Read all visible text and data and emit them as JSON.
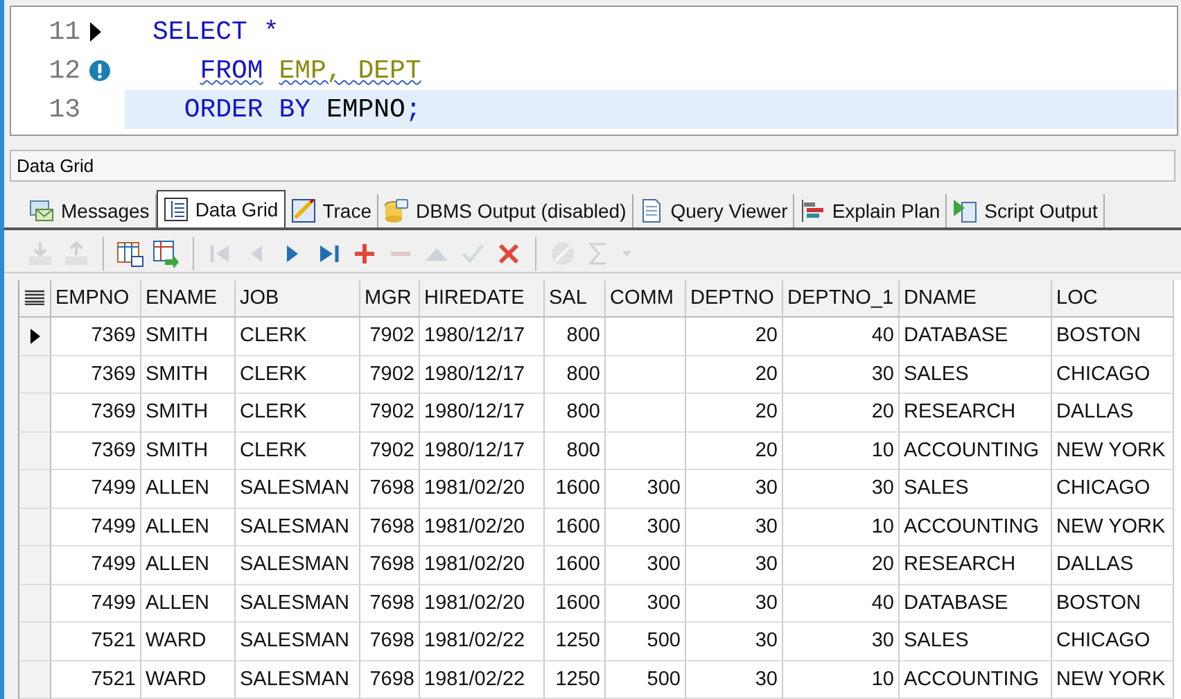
{
  "editor": {
    "lines": [
      {
        "number": "11",
        "execution_point": true,
        "warning": false,
        "current": false,
        "tokens": [
          {
            "text": "SELECT *",
            "kind": "keyword",
            "underlined": false
          }
        ]
      },
      {
        "number": "12",
        "execution_point": false,
        "warning": true,
        "current": false,
        "tokens": [
          {
            "text": "   FROM",
            "kind": "keyword",
            "underlined": true
          },
          {
            "text": " EMP, DEPT",
            "kind": "identifier",
            "underlined": true
          }
        ]
      },
      {
        "number": "13",
        "execution_point": false,
        "warning": false,
        "current": true,
        "tokens": [
          {
            "text": "  ORDER BY",
            "kind": "keyword",
            "underlined": false
          },
          {
            "text": " EMPNO",
            "kind": "plain",
            "underlined": false
          },
          {
            "text": ";",
            "kind": "keyword",
            "underlined": false
          }
        ]
      }
    ]
  },
  "panel": {
    "title": "Data Grid"
  },
  "tabs": [
    {
      "label": "Messages",
      "selected": false
    },
    {
      "label": "Data Grid",
      "selected": true
    },
    {
      "label": "Trace",
      "selected": false
    },
    {
      "label": "DBMS Output (disabled)",
      "selected": false
    },
    {
      "label": "Query Viewer",
      "selected": false
    },
    {
      "label": "Explain Plan",
      "selected": false
    },
    {
      "label": "Script Output",
      "selected": false
    }
  ],
  "toolbar": [
    {
      "kind": "export",
      "disabled": true
    },
    {
      "kind": "import",
      "disabled": true
    },
    {
      "kind": "separator"
    },
    {
      "kind": "grid-edit",
      "disabled": false
    },
    {
      "kind": "grid-send",
      "disabled": false
    },
    {
      "kind": "separator"
    },
    {
      "kind": "first",
      "disabled": true
    },
    {
      "kind": "prev",
      "disabled": true
    },
    {
      "kind": "next",
      "disabled": false
    },
    {
      "kind": "last",
      "disabled": false
    },
    {
      "kind": "add",
      "disabled": false
    },
    {
      "kind": "remove",
      "disabled": true
    },
    {
      "kind": "up",
      "disabled": true
    },
    {
      "kind": "confirm",
      "disabled": true
    },
    {
      "kind": "cancel",
      "disabled": false
    },
    {
      "kind": "separator"
    },
    {
      "kind": "clear",
      "disabled": true
    },
    {
      "kind": "sum",
      "disabled": true
    },
    {
      "kind": "dropdown",
      "disabled": true
    }
  ],
  "grid": {
    "columns": [
      {
        "label": "EMPNO",
        "kind": "number"
      },
      {
        "label": "ENAME",
        "kind": "text"
      },
      {
        "label": "JOB",
        "kind": "text"
      },
      {
        "label": "MGR",
        "kind": "number"
      },
      {
        "label": "HIREDATE",
        "kind": "text"
      },
      {
        "label": "SAL",
        "kind": "number"
      },
      {
        "label": "COMM",
        "kind": "number"
      },
      {
        "label": "DEPTNO",
        "kind": "number"
      },
      {
        "label": "DEPTNO_1",
        "kind": "number"
      },
      {
        "label": "DNAME",
        "kind": "text"
      },
      {
        "label": "LOC",
        "kind": "text"
      }
    ],
    "rows": [
      {
        "selected": true,
        "cells": [
          "7369",
          "SMITH",
          "CLERK",
          "7902",
          "1980/12/17",
          "800",
          "",
          "20",
          "40",
          "DATABASE",
          "BOSTON"
        ]
      },
      {
        "selected": false,
        "cells": [
          "7369",
          "SMITH",
          "CLERK",
          "7902",
          "1980/12/17",
          "800",
          "",
          "20",
          "30",
          "SALES",
          "CHICAGO"
        ]
      },
      {
        "selected": false,
        "cells": [
          "7369",
          "SMITH",
          "CLERK",
          "7902",
          "1980/12/17",
          "800",
          "",
          "20",
          "20",
          "RESEARCH",
          "DALLAS"
        ]
      },
      {
        "selected": false,
        "cells": [
          "7369",
          "SMITH",
          "CLERK",
          "7902",
          "1980/12/17",
          "800",
          "",
          "20",
          "10",
          "ACCOUNTING",
          "NEW YORK"
        ]
      },
      {
        "selected": false,
        "cells": [
          "7499",
          "ALLEN",
          "SALESMAN",
          "7698",
          "1981/02/20",
          "1600",
          "300",
          "30",
          "30",
          "SALES",
          "CHICAGO"
        ]
      },
      {
        "selected": false,
        "cells": [
          "7499",
          "ALLEN",
          "SALESMAN",
          "7698",
          "1981/02/20",
          "1600",
          "300",
          "30",
          "10",
          "ACCOUNTING",
          "NEW YORK"
        ]
      },
      {
        "selected": false,
        "cells": [
          "7499",
          "ALLEN",
          "SALESMAN",
          "7698",
          "1981/02/20",
          "1600",
          "300",
          "30",
          "20",
          "RESEARCH",
          "DALLAS"
        ]
      },
      {
        "selected": false,
        "cells": [
          "7499",
          "ALLEN",
          "SALESMAN",
          "7698",
          "1981/02/20",
          "1600",
          "300",
          "30",
          "40",
          "DATABASE",
          "BOSTON"
        ]
      },
      {
        "selected": false,
        "cells": [
          "7521",
          "WARD",
          "SALESMAN",
          "7698",
          "1981/02/22",
          "1250",
          "500",
          "30",
          "30",
          "SALES",
          "CHICAGO"
        ]
      },
      {
        "selected": false,
        "cells": [
          "7521",
          "WARD",
          "SALESMAN",
          "7698",
          "1981/02/22",
          "1250",
          "500",
          "30",
          "10",
          "ACCOUNTING",
          "NEW YORK"
        ]
      }
    ]
  }
}
